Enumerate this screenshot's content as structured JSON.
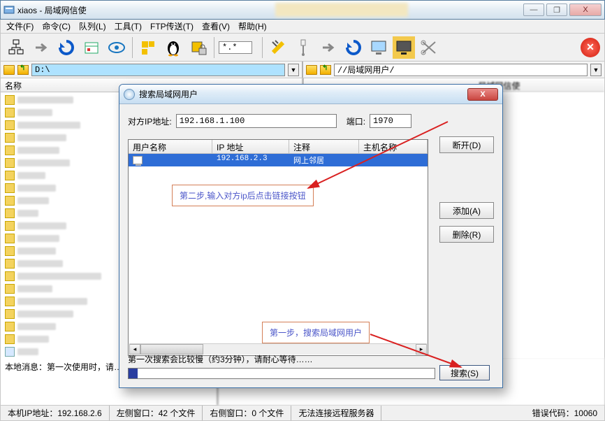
{
  "window": {
    "title": "xiaos - 局域网信使",
    "min": "—",
    "max": "❐",
    "close": "X"
  },
  "menu": {
    "file": "文件(F)",
    "cmd": "命令(C)",
    "queue": "队列(L)",
    "tool": "工具(T)",
    "ftp": "FTP传送(T)",
    "view": "查看(V)",
    "help": "帮助(H)"
  },
  "toolbar": {
    "mask": "*.*"
  },
  "path": {
    "left": "D:\\",
    "right": "//局域网用户/"
  },
  "pane": {
    "left_header": "名称",
    "right_header": "局域网信使"
  },
  "log": {
    "left": "本地消息：第一次使用时，请…",
    "right": ""
  },
  "status": {
    "ip": "本机IP地址：192.168.2.6",
    "leftwin": "左侧窗口：42 个文件",
    "rightwin": "右侧窗口：0 个文件",
    "conn": "无法连接远程服务器",
    "err": "错误代码：10060"
  },
  "dialog": {
    "title": "搜索局域网用户",
    "ip_label": "对方IP地址:",
    "ip_value": "192.168.1.100",
    "port_label": "端口:",
    "port_value": "1970",
    "disconnect": "断开(D)",
    "add": "添加(A)",
    "del": "删除(R)",
    "search": "搜索(S)",
    "cols": {
      "user": "用户名称",
      "ip": "IP 地址",
      "note": "注释",
      "host": "主机名称"
    },
    "row": {
      "user": "",
      "ip": "192.168.2.3",
      "note": "网上邻居",
      "host": ""
    },
    "progress_label": "第一次搜索会比较慢（约3分钟），请耐心等待……"
  },
  "annot": {
    "step1": "第一步，搜索局域网用户",
    "step2": "第二步,输入对方ip后点击链接按钮"
  }
}
